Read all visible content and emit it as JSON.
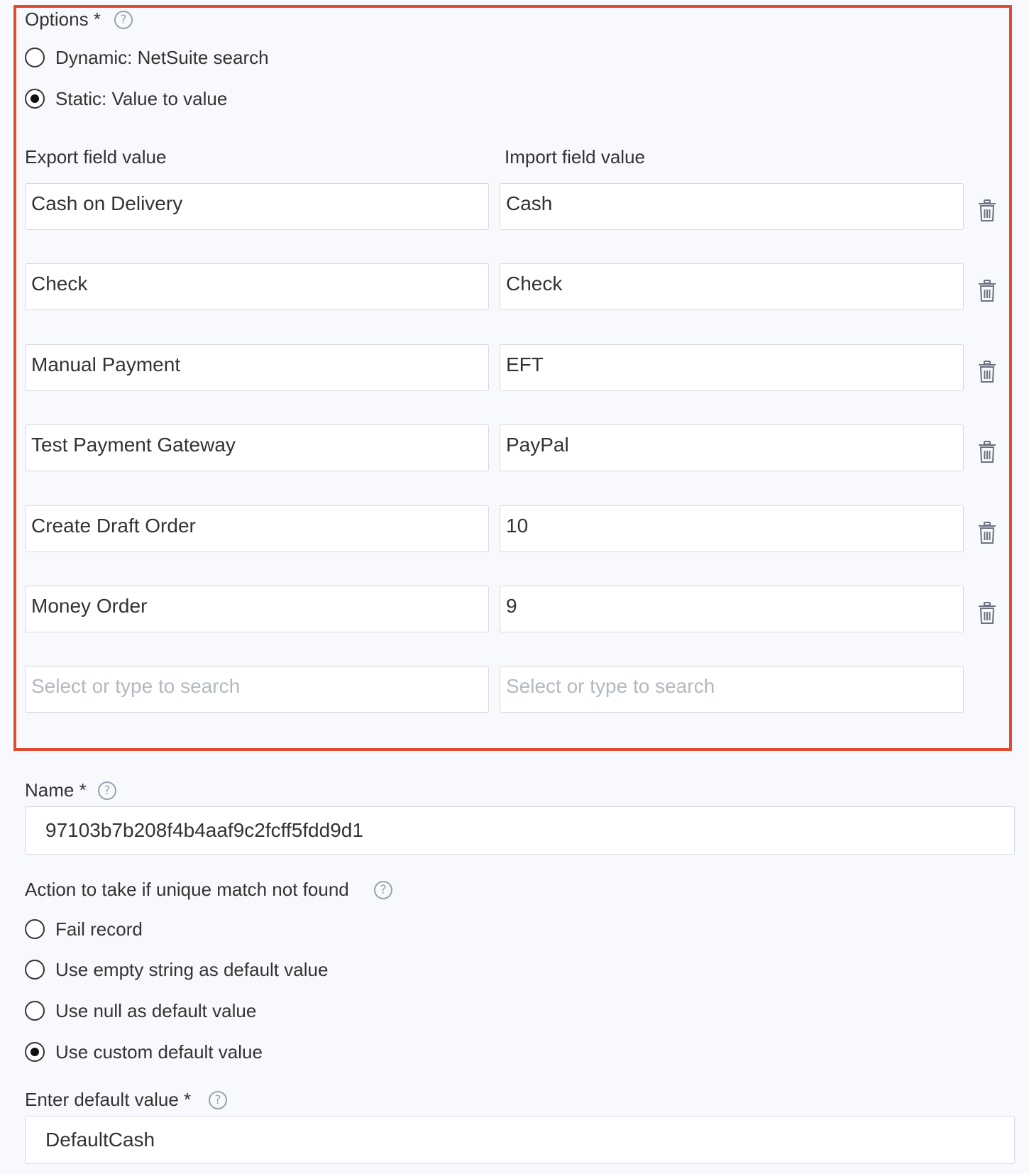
{
  "options": {
    "label": "Options *",
    "help": "?",
    "radios": [
      {
        "label": "Dynamic: NetSuite search",
        "checked": false
      },
      {
        "label": "Static: Value to value",
        "checked": true
      }
    ],
    "export_header": "Export field value",
    "import_header": "Import field value",
    "rows": [
      {
        "export": "Cash on Delivery",
        "import": "Cash"
      },
      {
        "export": "Check",
        "import": "Check"
      },
      {
        "export": "Manual Payment",
        "import": "EFT"
      },
      {
        "export": "Test Payment Gateway",
        "import": "PayPal"
      },
      {
        "export": "Create Draft Order",
        "import": "10"
      },
      {
        "export": "Money Order",
        "import": "9"
      }
    ],
    "new_row": {
      "export_placeholder": "Select or type to search",
      "import_placeholder": "Select or type to search"
    }
  },
  "name": {
    "label": "Name *",
    "help": "?",
    "value": "97103b7b208f4b4aaf9c2fcff5fdd9d1"
  },
  "action": {
    "label": "Action to take if unique match not found",
    "help": "?",
    "radios": [
      {
        "label": "Fail record",
        "checked": false
      },
      {
        "label": "Use empty string as default value",
        "checked": false
      },
      {
        "label": "Use null as default value",
        "checked": false
      },
      {
        "label": "Use custom default value",
        "checked": true
      }
    ]
  },
  "default_value": {
    "label": "Enter default value *",
    "help": "?",
    "value": "DefaultCash"
  },
  "colors": {
    "highlight": "#e04b33",
    "background": "#f7f9fc",
    "text": "#333333",
    "placeholder": "#b3b9c0"
  },
  "icons": {
    "delete": "trash-icon",
    "help": "help-circle-icon"
  }
}
